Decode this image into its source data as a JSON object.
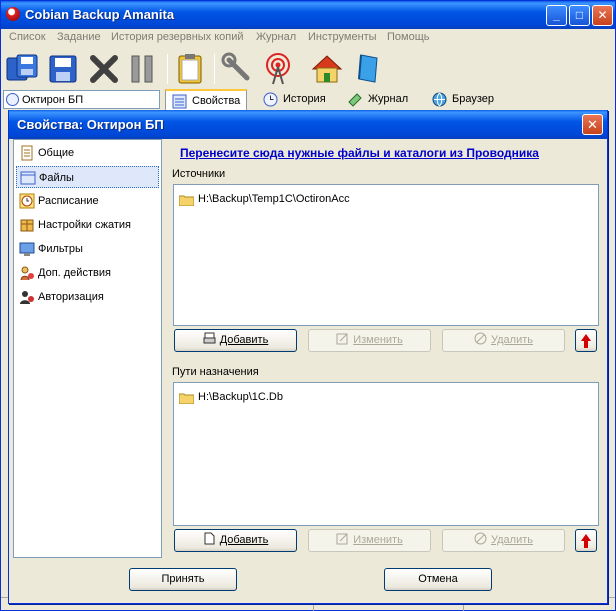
{
  "window": {
    "title": "Cobian Backup Amanita",
    "minimize_glyph": "_",
    "maximize_glyph": "□",
    "close_glyph": "✕"
  },
  "menu": [
    "Список",
    "Задание",
    "История резервных копий",
    "Журнал",
    "Инструменты",
    "Помощь"
  ],
  "toolbar_icons": [
    "backup-all-icon",
    "save-icon",
    "delete-icon",
    "pause-icon",
    "clipboard-icon",
    "wrench-icon",
    "antenna-icon",
    "home-icon",
    "book-icon"
  ],
  "task_field": {
    "value": "Октирон БП"
  },
  "main_tabs": [
    {
      "label": "Свойства",
      "icon": "properties-icon"
    },
    {
      "label": "История",
      "icon": "history-clock-icon"
    },
    {
      "label": "Журнал",
      "icon": "log-icon"
    },
    {
      "label": "Браузер",
      "icon": "browser-globe-icon"
    }
  ],
  "dialog": {
    "title": "Свойства: Октирон БП",
    "close_glyph": "✕",
    "nav": [
      {
        "label": "Общие",
        "icon": "general-icon"
      },
      {
        "label": "Файлы",
        "icon": "files-icon"
      },
      {
        "label": "Расписание",
        "icon": "schedule-icon"
      },
      {
        "label": "Настройки сжатия",
        "icon": "compression-icon"
      },
      {
        "label": "Фильтры",
        "icon": "filter-icon"
      },
      {
        "label": "Доп. действия",
        "icon": "extra-actions-icon"
      },
      {
        "label": "Авторизация",
        "icon": "authorization-icon"
      }
    ],
    "selected_nav": "Файлы",
    "drop_hint": "Перенесите сюда нужные файлы и каталоги из Проводника",
    "sources": {
      "label": "Источники",
      "items": [
        "H:\\Backup\\Temp1C\\OctironAcc"
      ],
      "add": "Добавить",
      "edit": "Изменить",
      "delete": "Удалить"
    },
    "destinations": {
      "label": "Пути назначения",
      "items": [
        "H:\\Backup\\1C.Db"
      ],
      "add": "Добавить",
      "edit": "Изменить",
      "delete": "Удалить"
    },
    "ok": "Принять",
    "cancel": "Отмена"
  },
  "colors": {
    "titlebar": "#0055e5",
    "link": "#0000cc",
    "up_arrow": "#d20000"
  }
}
